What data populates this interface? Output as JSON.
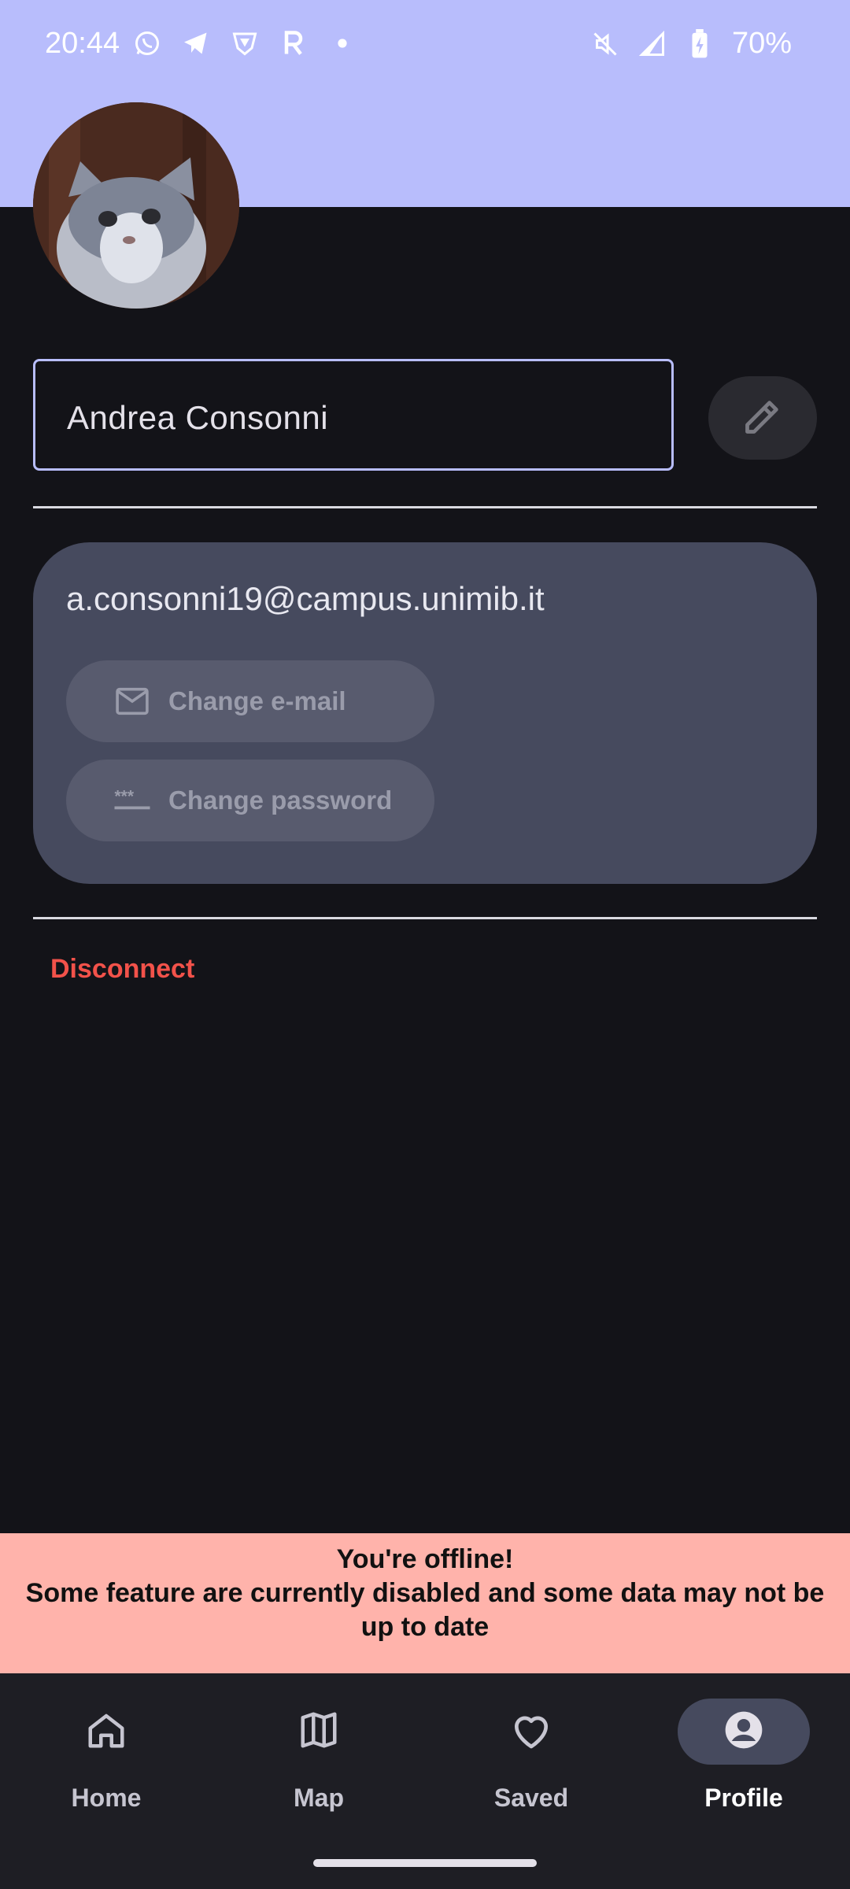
{
  "status_bar": {
    "time": "20:44",
    "battery": "70%",
    "left_icons": [
      "whatsapp-icon",
      "telegram-icon",
      "shield-app-icon",
      "r-app-icon",
      "dot-icon"
    ],
    "right_icons": [
      "mute-icon",
      "signal-icon",
      "battery-icon"
    ]
  },
  "profile": {
    "name": "Andrea Consonni",
    "email": "a.consonni19@campus.unimib.it"
  },
  "account": {
    "change_email_label": "Change e-mail",
    "change_password_label": "Change password"
  },
  "disconnect_label": "Disconnect",
  "offline_banner": {
    "title": "You're offline!",
    "message": "Some feature are currently disabled and some data may not be up to date"
  },
  "nav": {
    "items": [
      {
        "label": "Home",
        "icon": "home-icon"
      },
      {
        "label": "Map",
        "icon": "map-icon"
      },
      {
        "label": "Saved",
        "icon": "heart-icon"
      },
      {
        "label": "Profile",
        "icon": "profile-icon",
        "active": true
      }
    ]
  },
  "colors": {
    "header": "#b8bdfc",
    "background": "#131318",
    "card": "#464a5e",
    "danger": "#f2524a",
    "offline_banner": "#ffb3ab"
  }
}
